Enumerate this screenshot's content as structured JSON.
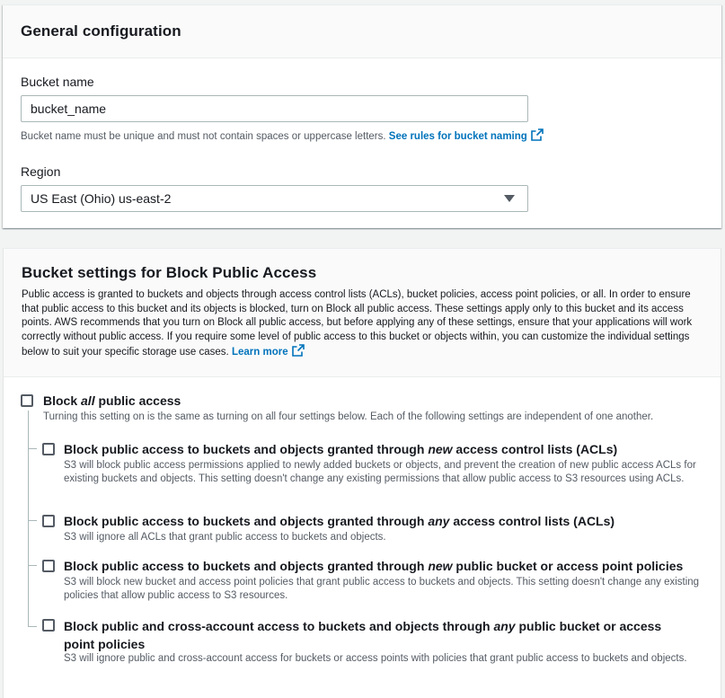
{
  "general": {
    "title": "General configuration",
    "bucket_name_label": "Bucket name",
    "bucket_name_value": "bucket_name",
    "bucket_name_hint": "Bucket name must be unique and must not contain spaces or uppercase letters.",
    "bucket_naming_link": "See rules for bucket naming",
    "region_label": "Region",
    "region_value": "US East (Ohio) us-east-2"
  },
  "block_access": {
    "title": "Bucket settings for Block Public Access",
    "description": "Public access is granted to buckets and objects through access control lists (ACLs), bucket policies, access point policies, or all. In order to ensure that public access to this bucket and its objects is blocked, turn on Block all public access. These settings apply only to this bucket and its access points. AWS recommends that you turn on Block all public access, but before applying any of these settings, ensure that your applications will work correctly without public access. If you require some level of public access to this bucket or objects within, you can customize the individual settings below to suit your specific storage use cases.",
    "learn_more": "Learn more",
    "all": {
      "title_pre": "Block ",
      "title_em": "all",
      "title_post": " public access",
      "desc": "Turning this setting on is the same as turning on all four settings below. Each of the following settings are independent of one another.",
      "checked": false
    },
    "options": [
      {
        "title_pre": "Block public access to buckets and objects granted through ",
        "title_em": "new",
        "title_post": " access control lists (ACLs)",
        "desc": "S3 will block public access permissions applied to newly added buckets or objects, and prevent the creation of new public access ACLs for existing buckets and objects. This setting doesn't change any existing permissions that allow public access to S3 resources using ACLs.",
        "checked": false
      },
      {
        "title_pre": "Block public access to buckets and objects granted through ",
        "title_em": "any",
        "title_post": " access control lists (ACLs)",
        "desc": "S3 will ignore all ACLs that grant public access to buckets and objects.",
        "checked": false
      },
      {
        "title_pre": "Block public access to buckets and objects granted through ",
        "title_em": "new",
        "title_post": " public bucket or access point policies",
        "desc": "S3 will block new bucket and access point policies that grant public access to buckets and objects. This setting doesn't change any existing policies that allow public access to S3 resources.",
        "checked": false
      },
      {
        "title_pre": "Block public and cross-account access to buckets and objects through ",
        "title_em": "any",
        "title_post": " public bucket or access point policies",
        "desc": "S3 will ignore public and cross-account access for buckets or access points with policies that grant public access to buckets and objects.",
        "checked": false
      }
    ]
  },
  "colors": {
    "link": "#0073bb",
    "page_bg": "#f2f3f3",
    "text": "#16191f",
    "muted": "#545b64"
  }
}
